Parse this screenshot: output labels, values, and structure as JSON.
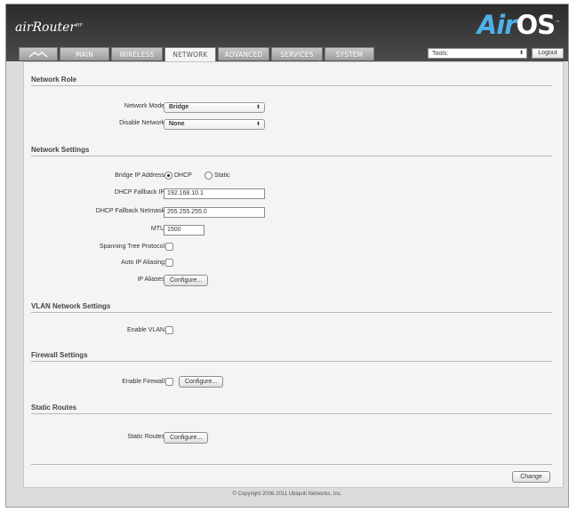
{
  "header": {
    "brand": "airRouter",
    "brand_mark": "HP",
    "logo_air": "Air",
    "logo_os": "OS",
    "logo_tm": "™",
    "tools_label": "Tools:",
    "logout_label": "Logout"
  },
  "tabs": [
    {
      "label": "",
      "icon": "ubiquiti-logo-icon",
      "active": false
    },
    {
      "label": "MAIN",
      "active": false
    },
    {
      "label": "WIRELESS",
      "active": false
    },
    {
      "label": "NETWORK",
      "active": true
    },
    {
      "label": "ADVANCED",
      "active": false
    },
    {
      "label": "SERVICES",
      "active": false
    },
    {
      "label": "SYSTEM",
      "active": false
    }
  ],
  "network_role": {
    "title": "Network Role",
    "mode_label": "Network Mode:",
    "mode_value": "Bridge",
    "disable_label": "Disable Network:",
    "disable_value": "None"
  },
  "network_settings": {
    "title": "Network Settings",
    "bridge_ip_label": "Bridge IP Address:",
    "dhcp_label": "DHCP",
    "static_label": "Static",
    "bridge_ip_mode": "DHCP",
    "fallback_ip_label": "DHCP Fallback IP:",
    "fallback_ip_value": "192.168.10.1",
    "fallback_netmask_label": "DHCP Fallback Netmask:",
    "fallback_netmask_value": "255.255.255.0",
    "mtu_label": "MTU:",
    "mtu_value": "1500",
    "stp_label": "Spanning Tree Protocol:",
    "auto_ip_label": "Auto IP Aliasing:",
    "ip_aliases_label": "IP Aliases:",
    "configure_label": "Configure..."
  },
  "vlan": {
    "title": "VLAN Network Settings",
    "enable_label": "Enable VLAN:"
  },
  "firewall": {
    "title": "Firewall Settings",
    "enable_label": "Enable Firewall:",
    "configure_label": "Configure..."
  },
  "static_routes": {
    "title": "Static Routes",
    "label": "Static Routes:",
    "configure_label": "Configure..."
  },
  "change_label": "Change",
  "footer": "© Copyright 2006-2011 Ubiquiti Networks, Inc."
}
